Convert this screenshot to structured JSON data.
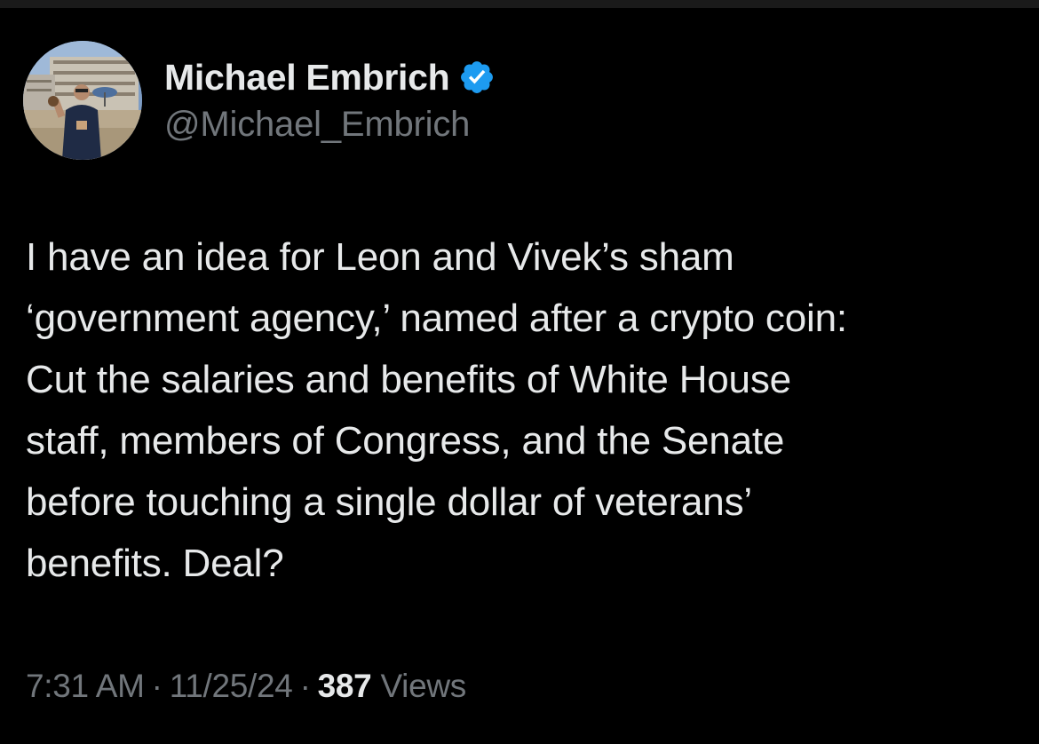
{
  "author": {
    "display_name": "Michael Embrich",
    "handle": "@Michael_Embrich",
    "verified": true,
    "verified_color": "#1d9bf0"
  },
  "tweet": {
    "text_lines": [
      "I have an idea for Leon and Vivek’s sham",
      "‘government agency,’ named after a crypto coin:",
      "Cut the salaries and benefits of White House",
      "staff, members of Congress, and the Senate",
      "before touching a single dollar of veterans’",
      "benefits. Deal?"
    ]
  },
  "meta": {
    "time": "7:31 AM",
    "separator": "·",
    "date": "11/25/24",
    "views_count": "387",
    "views_label": "Views"
  },
  "colors": {
    "background": "#000000",
    "text_primary": "#e7e9ea",
    "text_secondary": "#71767b"
  }
}
